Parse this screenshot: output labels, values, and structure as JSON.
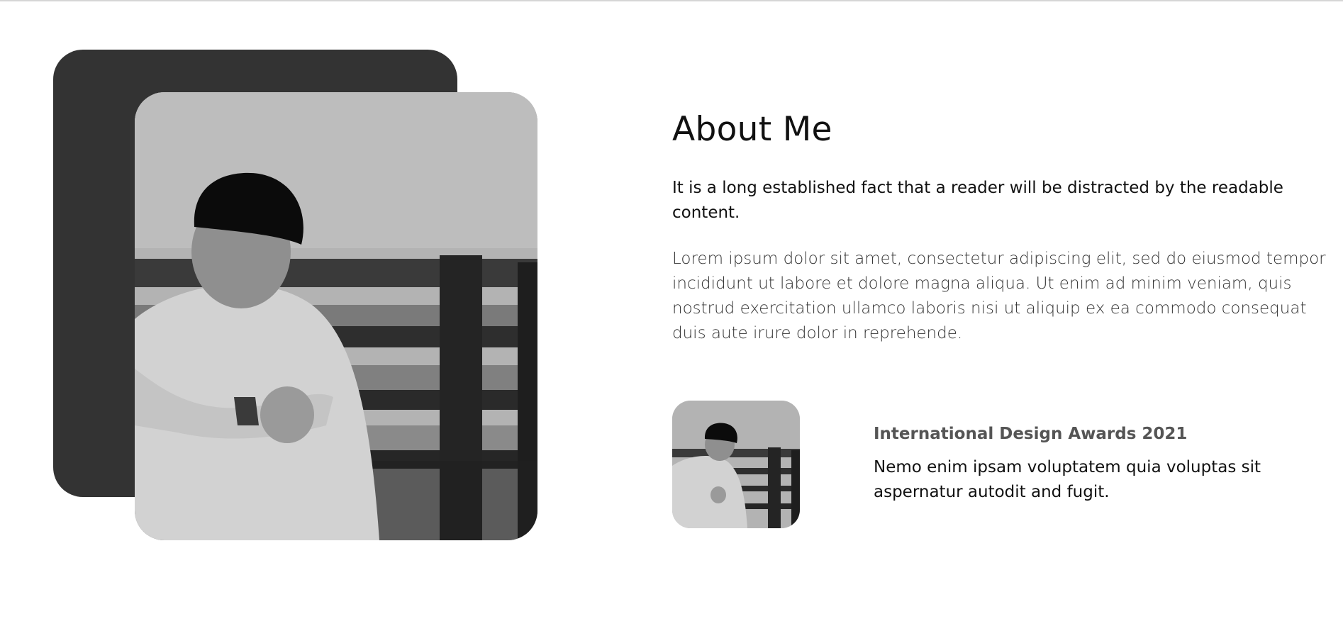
{
  "about": {
    "heading": "About Me",
    "lead": "It is a long established fact that a reader will be distracted by the readable content.",
    "body": "Lorem ipsum dolor sit amet, consectetur adipiscing elit, sed do eiusmod tempor incididunt ut labore et dolore magna aliqua. Ut enim ad minim veniam, quis nostrud exercitation ullamco laboris nisi ut aliquip ex ea commodo consequat duis aute irure dolor in reprehende."
  },
  "award": {
    "title": "International Design Awards 2021",
    "description": "Nemo enim ipsam voluptatem quia voluptas sit aspernatur autodit and fugit."
  },
  "colors": {
    "back_card": "#333333",
    "text": "#111111",
    "award_title": "#555555"
  }
}
